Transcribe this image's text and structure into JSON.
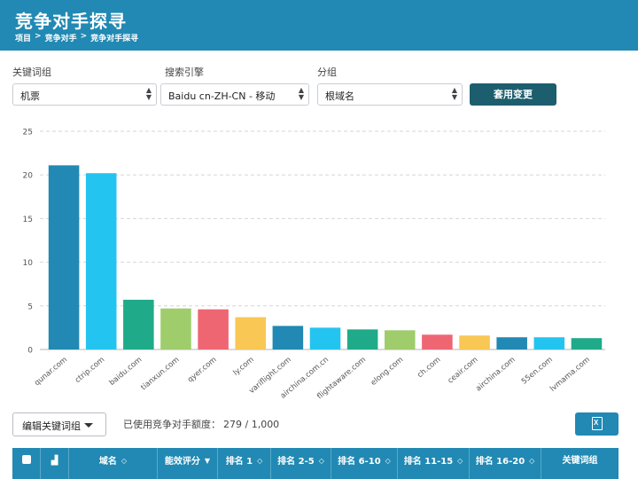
{
  "header": {
    "title": "竞争对手探寻",
    "breadcrumb": [
      "项目",
      "竞争对手",
      "竞争对手探寻"
    ],
    "separator": ">"
  },
  "filters": {
    "keyword_group": {
      "label": "关键词组",
      "value": "机票"
    },
    "search_engine": {
      "label": "搜索引擎",
      "value": "Baidu cn-ZH-CN - 移动"
    },
    "grouping": {
      "label": "分组",
      "value": "根域名"
    },
    "apply_label": "套用变更"
  },
  "chart_data": {
    "type": "bar",
    "categories": [
      "qunar.com",
      "ctrip.com",
      "baidu.com",
      "tianxun.com",
      "qyer.com",
      "ly.com",
      "variflight.com",
      "airchina.com.cn",
      "flightaware.com",
      "elong.com",
      "ch.com",
      "ceair.com",
      "airchina.com",
      "55en.com",
      "lvmama.com"
    ],
    "values": [
      21.1,
      20.2,
      5.7,
      4.7,
      4.6,
      3.7,
      2.7,
      2.5,
      2.3,
      2.2,
      1.7,
      1.6,
      1.4,
      1.4,
      1.3
    ],
    "colors": [
      "#2189b3",
      "#23c4f0",
      "#1fab89",
      "#9fcd6b",
      "#ef6673",
      "#f8c754",
      "#2189b3",
      "#23c4f0",
      "#1fab89",
      "#9fcd6b",
      "#ef6673",
      "#f8c754",
      "#2189b3",
      "#23c4f0",
      "#1fab89"
    ],
    "yticks": [
      0,
      5,
      10,
      15,
      20,
      25
    ],
    "ylim": [
      0,
      25
    ],
    "grid": true,
    "title": "",
    "xlabel": "",
    "ylabel": ""
  },
  "toolbar": {
    "edit_label": "编辑关键词组",
    "quota_label": "已使用竞争对手额度：",
    "quota_value": "279 / 1,000",
    "export_icon": "excel-export-icon"
  },
  "table": {
    "columns": [
      "",
      "",
      "域名",
      "能效评分",
      "排名 1",
      "排名 2-5",
      "排名 6-10",
      "排名 11-15",
      "排名 16-20",
      "关键词组"
    ],
    "sort_active": "能效评分"
  }
}
